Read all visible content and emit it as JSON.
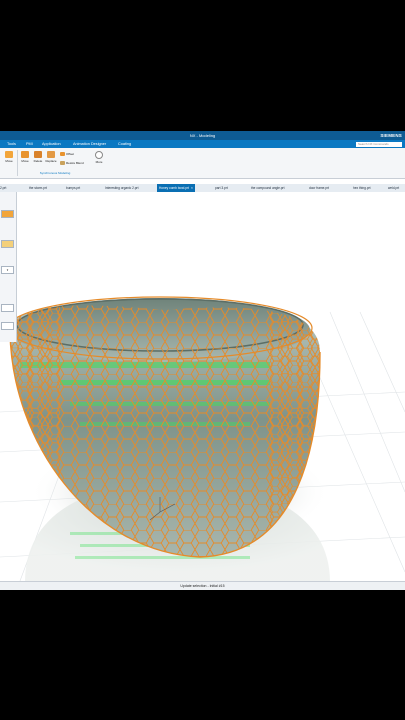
{
  "window": {
    "title": "NX - Modeling",
    "brand": "SIEMENS"
  },
  "menu": {
    "items": [
      "Tools",
      "PMI",
      "Application",
      "Animation Designer",
      "Coating"
    ],
    "search_placeholder": "Search NX Commands"
  },
  "ribbon": {
    "buttons": [
      "Move",
      "Delete",
      "Replace",
      "Offset",
      "Resize Blend",
      "More"
    ],
    "row_labels": [
      "Move",
      "Move",
      "Delete",
      "Replace"
    ],
    "group_label": "Synchronous Modeling"
  },
  "tabs": [
    {
      "label": "2.prt"
    },
    {
      "label": "the storm.prt"
    },
    {
      "label": "bumps.prt"
    },
    {
      "label": "Interesting organic 2.prt"
    },
    {
      "label": "Honey comb bowl.prt",
      "active": true
    },
    {
      "label": "part 3.prt"
    },
    {
      "label": "the compound angle.prt"
    },
    {
      "label": "door frame.prt"
    },
    {
      "label": "hex thing.prt"
    },
    {
      "label": "weld.prt"
    }
  ],
  "status": {
    "text": "Update selection - Initial #15"
  },
  "colors": {
    "titlebar": "#0e5b93",
    "menubar": "#0a78c2",
    "active_tab": "#0a6fb3",
    "honeycomb": "#e58b2a",
    "glass": "#9fb3a9",
    "green_glow": "#3ee05a"
  }
}
